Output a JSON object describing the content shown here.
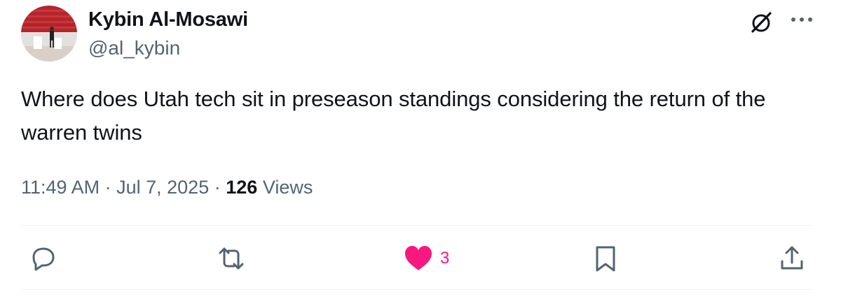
{
  "author": {
    "display_name": "Kybin Al-Mosawi",
    "handle": "@al_kybin"
  },
  "tweet": {
    "text": "Where does Utah tech sit in preseason standings considering the return of the warren twins",
    "time": "11:49 AM",
    "date": "Jul 7, 2025",
    "views_count": "126",
    "views_label": "Views",
    "separator": "·"
  },
  "actions": {
    "reply_icon": "reply-icon",
    "retweet_icon": "retweet-icon",
    "like_icon": "heart-filled-icon",
    "like_count": "3",
    "bookmark_icon": "bookmark-icon",
    "share_icon": "share-icon"
  },
  "header_icons": {
    "grok": "grok-icon",
    "more": "more-icon"
  },
  "colors": {
    "text_primary": "#0f1419",
    "text_secondary": "#536471",
    "like_pink": "#f91880",
    "divider": "#eff3f4"
  }
}
